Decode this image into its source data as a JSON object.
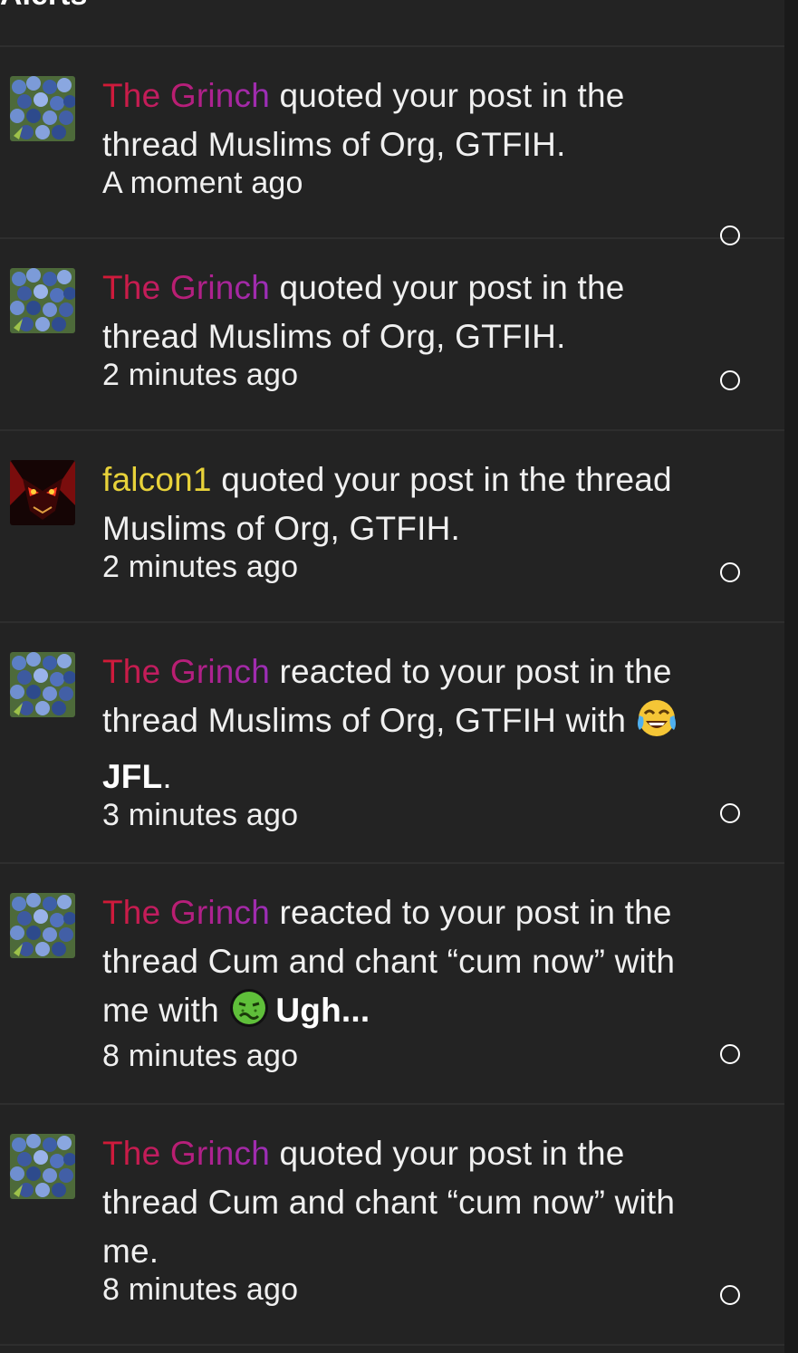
{
  "header": {
    "title": "Alerts"
  },
  "alerts": [
    {
      "user": "The Grinch",
      "text": " quoted your post in the thread Muslims of Org, GTFIH.",
      "time": "A moment ago"
    },
    {
      "user": "The Grinch",
      "text": " quoted your post in the thread Muslims of Org, GTFIH.",
      "time": "2 minutes ago"
    },
    {
      "user": "falcon1",
      "text": " quoted your post in the thread Muslims of Org, GTFIH.",
      "time": "2 minutes ago"
    },
    {
      "user": "The Grinch",
      "text": " reacted to your post in the thread Muslims of Org, GTFIH with ",
      "reaction": "JFL",
      "reaction_icon": "joy-tears-icon",
      "after": ".",
      "time": "3 minutes ago"
    },
    {
      "user": "The Grinch",
      "text": " reacted to your post in the thread Cum and chant “cum now” with me with ",
      "reaction": "Ugh...",
      "reaction_icon": "nauseated-face-icon",
      "time": "8 minutes ago"
    },
    {
      "user": "The Grinch",
      "text": " quoted your post in the thread Cum and chant “cum now” with me.",
      "time": "8 minutes ago"
    }
  ],
  "colors": {
    "grinch_gradient": [
      "#d21a33",
      "#9b2fb8"
    ],
    "falcon": "#e8d23a",
    "background": "#232323"
  }
}
